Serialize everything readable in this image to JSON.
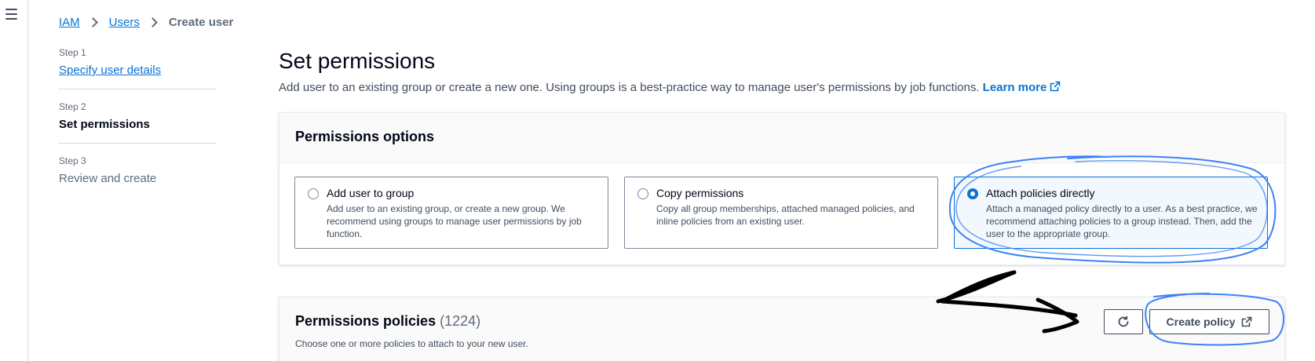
{
  "breadcrumb": {
    "items": [
      "IAM",
      "Users"
    ],
    "current": "Create user"
  },
  "steps": [
    {
      "number": "Step 1",
      "title": "Specify user details"
    },
    {
      "number": "Step 2",
      "title": "Set permissions"
    },
    {
      "number": "Step 3",
      "title": "Review and create"
    }
  ],
  "page": {
    "title": "Set permissions",
    "description": "Add user to an existing group or create a new one. Using groups is a best-practice way to manage user's permissions by job functions.",
    "learn_more": "Learn more"
  },
  "permissions_options": {
    "title": "Permissions options",
    "tiles": [
      {
        "title": "Add user to group",
        "description": "Add user to an existing group, or create a new group. We recommend using groups to manage user permissions by job function.",
        "selected": false
      },
      {
        "title": "Copy permissions",
        "description": "Copy all group memberships, attached managed policies, and inline policies from an existing user.",
        "selected": false
      },
      {
        "title": "Attach policies directly",
        "description": "Attach a managed policy directly to a user. As a best practice, we recommend attaching policies to a group instead. Then, add the user to the appropriate group.",
        "selected": true
      }
    ]
  },
  "permissions_policies": {
    "title": "Permissions policies",
    "count": "(1224)",
    "description": "Choose one or more policies to attach to your new user.",
    "create_label": "Create policy"
  },
  "icons": {
    "menu": "hamburger-menu-icon",
    "refresh": "refresh-icon",
    "external": "external-link-icon"
  },
  "colors": {
    "link": "#0972d3",
    "annotation_blue": "#3b82f6",
    "annotation_black": "#000000"
  }
}
